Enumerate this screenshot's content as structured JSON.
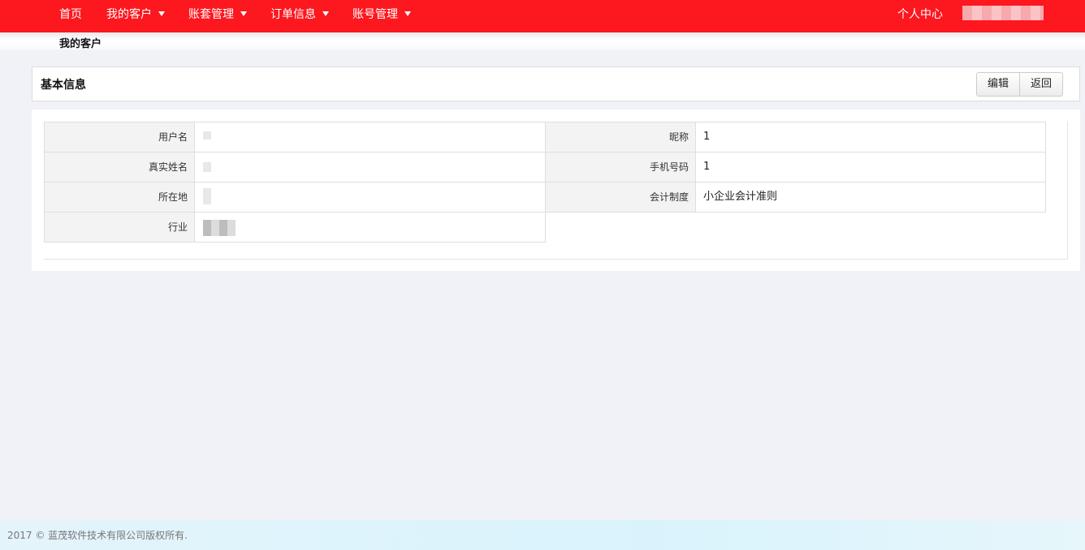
{
  "nav": {
    "home": "首页",
    "customers": "我的客户",
    "ledger": "账套管理",
    "orders": "订单信息",
    "accounts": "账号管理",
    "personal_center": "个人中心"
  },
  "breadcrumb": "我的客户",
  "panel": {
    "title": "基本信息",
    "edit_label": "编辑",
    "back_label": "返回"
  },
  "fields": {
    "username_label": "用户名",
    "username_value": "",
    "nickname_label": "昵称",
    "nickname_value": "1",
    "realname_label": "真实姓名",
    "realname_value": "",
    "phone_label": "手机号码",
    "phone_value": "1",
    "location_label": "所在地",
    "location_value": "",
    "accounting_label": "会计制度",
    "accounting_value": "小企业会计准则",
    "industry_label": "行业",
    "industry_value": ""
  },
  "footer": "2017 © 蓝茂软件技术有限公司版权所有.",
  "colors": {
    "topbar": "#fd171e",
    "page_bg": "#f0f2f7",
    "label_bg": "#f3f3f3"
  }
}
